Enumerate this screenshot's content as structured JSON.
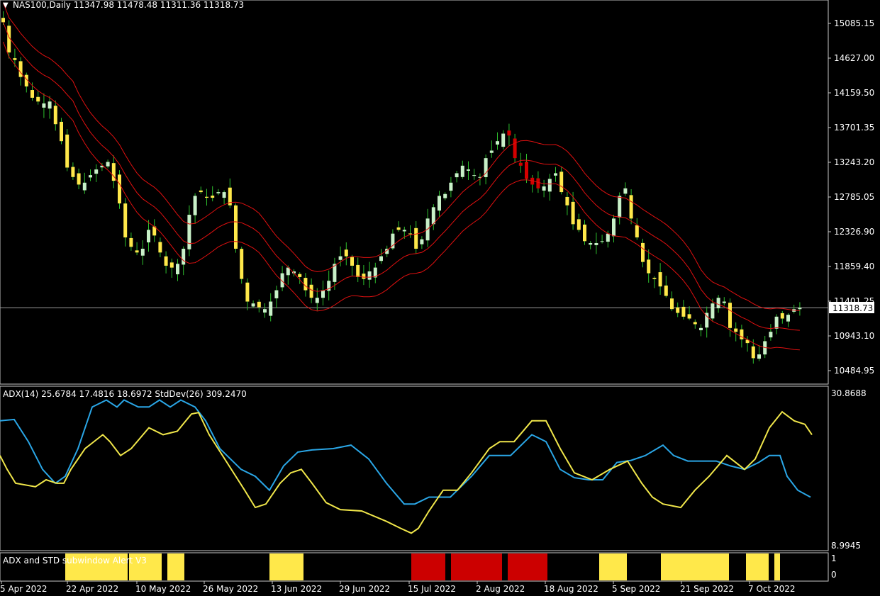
{
  "colors": {
    "background": "#000000",
    "bull_candle": "#c8f0c8",
    "bear_yellow": "#ffe84a",
    "bear_red": "#d40000",
    "wick": "#2dbe2d",
    "envelope": "#e01010",
    "price_line": "#9a9a9a",
    "adx_blue": "#2aa6e6",
    "std_yellow": "#f0e64a",
    "alert_yellow": "#ffe84a",
    "alert_red": "#cc0000",
    "frame": "#c8c8c8"
  },
  "main": {
    "symbol_header": "NAS100,Daily  11347.98 11478.48 11311.36 11318.73",
    "price_tag": "11318.73",
    "current_price": 11318.73
  },
  "adx_panel": {
    "header": "ADX(14) 25.6784 17.4816 18.6972  StdDev(26) 309.2470",
    "scale_top": "30.8688",
    "scale_bottom": "8.9945"
  },
  "alert_panel": {
    "header": "ADX and STD subwindow Alert V3",
    "scale_top": "1",
    "scale_bottom": "0"
  },
  "x_axis": {
    "labels": [
      "5 Apr 2022",
      "22 Apr 2022",
      "10 May 2022",
      "26 May 2022",
      "13 Jun 2022",
      "29 Jun 2022",
      "15 Jul 2022",
      "2 Aug 2022",
      "18 Aug 2022",
      "5 Sep 2022",
      "21 Sep 2022",
      "7 Oct 2022"
    ]
  },
  "chart_data": [
    {
      "type": "candlestick",
      "title": "NAS100,Daily",
      "y_ticks": [
        "15085.15",
        "14627.00",
        "14159.50",
        "13701.35",
        "13243.20",
        "12785.05",
        "12326.90",
        "11859.40",
        "11401.25",
        "10943.10",
        "10484.95"
      ],
      "ylim": [
        10350,
        15250
      ],
      "close_path": [
        [
          0,
          15100
        ],
        [
          2,
          14700
        ],
        [
          4,
          14500
        ],
        [
          6,
          14250
        ],
        [
          8,
          14100
        ],
        [
          10,
          14000
        ],
        [
          12,
          14050
        ],
        [
          14,
          13750
        ],
        [
          16,
          13300
        ],
        [
          18,
          13050
        ],
        [
          20,
          12950
        ],
        [
          22,
          13000
        ],
        [
          24,
          13150
        ],
        [
          26,
          13200
        ],
        [
          28,
          13300
        ],
        [
          30,
          12700
        ],
        [
          32,
          12250
        ],
        [
          34,
          12000
        ],
        [
          36,
          12100
        ],
        [
          38,
          12350
        ],
        [
          40,
          12200
        ],
        [
          42,
          11900
        ],
        [
          44,
          11850
        ],
        [
          46,
          11900
        ],
        [
          48,
          12300
        ],
        [
          50,
          12800
        ],
        [
          52,
          12850
        ],
        [
          54,
          12700
        ],
        [
          56,
          12850
        ],
        [
          58,
          12850
        ],
        [
          60,
          12500
        ],
        [
          62,
          11700
        ],
        [
          64,
          11400
        ],
        [
          66,
          11350
        ],
        [
          68,
          11300
        ],
        [
          70,
          11400
        ],
        [
          72,
          11700
        ],
        [
          74,
          11850
        ],
        [
          76,
          11800
        ],
        [
          78,
          11650
        ],
        [
          80,
          11450
        ],
        [
          82,
          11450
        ],
        [
          84,
          11550
        ],
        [
          86,
          11800
        ],
        [
          88,
          12000
        ],
        [
          90,
          12000
        ],
        [
          92,
          11750
        ],
        [
          94,
          11700
        ],
        [
          96,
          11800
        ],
        [
          98,
          11900
        ],
        [
          100,
          12100
        ],
        [
          102,
          12300
        ],
        [
          104,
          12400
        ],
        [
          106,
          12300
        ],
        [
          108,
          12100
        ],
        [
          110,
          12350
        ],
        [
          112,
          12650
        ],
        [
          114,
          12800
        ],
        [
          116,
          12850
        ],
        [
          118,
          13100
        ],
        [
          120,
          13200
        ],
        [
          122,
          13100
        ],
        [
          124,
          13050
        ],
        [
          126,
          13300
        ],
        [
          128,
          13400
        ],
        [
          130,
          13650
        ],
        [
          132,
          13600
        ],
        [
          134,
          13300
        ],
        [
          136,
          13100
        ],
        [
          138,
          12950
        ],
        [
          140,
          12900
        ],
        [
          142,
          12950
        ],
        [
          144,
          13100
        ],
        [
          146,
          12850
        ],
        [
          148,
          12500
        ],
        [
          150,
          12350
        ],
        [
          152,
          12200
        ],
        [
          154,
          12150
        ],
        [
          156,
          12200
        ],
        [
          158,
          12300
        ],
        [
          160,
          12700
        ],
        [
          162,
          12900
        ],
        [
          164,
          12500
        ],
        [
          166,
          12000
        ],
        [
          168,
          11850
        ],
        [
          170,
          11700
        ],
        [
          172,
          11600
        ],
        [
          174,
          11350
        ],
        [
          176,
          11250
        ],
        [
          178,
          11200
        ],
        [
          180,
          11150
        ],
        [
          182,
          11050
        ],
        [
          184,
          11250
        ],
        [
          186,
          11500
        ],
        [
          188,
          11400
        ],
        [
          190,
          11050
        ],
        [
          192,
          10950
        ],
        [
          194,
          10850
        ],
        [
          196,
          10650
        ],
        [
          198,
          10750
        ],
        [
          200,
          11000
        ],
        [
          202,
          11200
        ],
        [
          204,
          11150
        ],
        [
          206,
          11300
        ],
        [
          208,
          11318.73
        ]
      ]
    },
    {
      "type": "line",
      "title": "ADX(14) 25.6784 17.4816 18.6972  StdDev(26) 309.2470",
      "ylim": [
        8.9945,
        30.8688
      ],
      "series": [
        {
          "values": [
            [
              0,
              27
            ],
            [
              20,
              27.2
            ],
            [
              40,
              24
            ],
            [
              60,
              20
            ],
            [
              78,
              18
            ],
            [
              92,
              19
            ],
            [
              110,
              23
            ],
            [
              130,
              29
            ],
            [
              150,
              30
            ],
            [
              165,
              29
            ],
            [
              175,
              30
            ],
            [
              195,
              29
            ],
            [
              210,
              29
            ],
            [
              225,
              30
            ],
            [
              240,
              29
            ],
            [
              255,
              30
            ],
            [
              275,
              29
            ],
            [
              290,
              27
            ],
            [
              310,
              23
            ],
            [
              340,
              20
            ],
            [
              360,
              19
            ],
            [
              380,
              17
            ],
            [
              400,
              20.5
            ],
            [
              420,
              22.5
            ],
            [
              440,
              22.8
            ],
            [
              470,
              23
            ],
            [
              495,
              23.5
            ],
            [
              520,
              21.5
            ],
            [
              545,
              18
            ],
            [
              570,
              15
            ],
            [
              585,
              15
            ],
            [
              605,
              16
            ],
            [
              635,
              16
            ],
            [
              665,
              19
            ],
            [
              690,
              22
            ],
            [
              720,
              22
            ],
            [
              750,
              25
            ],
            [
              770,
              24
            ],
            [
              790,
              20
            ],
            [
              810,
              18.8
            ],
            [
              830,
              18.5
            ],
            [
              850,
              18.5
            ],
            [
              870,
              21
            ],
            [
              890,
              21.3
            ],
            [
              910,
              22
            ],
            [
              935,
              23.5
            ],
            [
              950,
              22
            ],
            [
              970,
              21.2
            ],
            [
              990,
              21.2
            ],
            [
              1010,
              21.2
            ],
            [
              1030,
              20.5
            ],
            [
              1050,
              20
            ],
            [
              1070,
              21
            ],
            [
              1085,
              22
            ],
            [
              1100,
              22
            ],
            [
              1110,
              19
            ],
            [
              1125,
              17
            ],
            [
              1143,
              16
            ]
          ]
        },
        {
          "values": [
            [
              0,
              22
            ],
            [
              10,
              20
            ],
            [
              22,
              18
            ],
            [
              50,
              17.5
            ],
            [
              65,
              18.5
            ],
            [
              80,
              18
            ],
            [
              90,
              18
            ],
            [
              100,
              20
            ],
            [
              120,
              23
            ],
            [
              145,
              25
            ],
            [
              155,
              24
            ],
            [
              170,
              22
            ],
            [
              185,
              23
            ],
            [
              210,
              26
            ],
            [
              230,
              25
            ],
            [
              250,
              25.5
            ],
            [
              270,
              28
            ],
            [
              280,
              28.2
            ],
            [
              295,
              25
            ],
            [
              320,
              21
            ],
            [
              345,
              17
            ],
            [
              360,
              14.5
            ],
            [
              375,
              15
            ],
            [
              395,
              18
            ],
            [
              410,
              19.5
            ],
            [
              425,
              20
            ],
            [
              440,
              18
            ],
            [
              460,
              15.2
            ],
            [
              480,
              14.2
            ],
            [
              510,
              14
            ],
            [
              545,
              12.5
            ],
            [
              565,
              11.5
            ],
            [
              580,
              10.8
            ],
            [
              590,
              11.5
            ],
            [
              605,
              14
            ],
            [
              625,
              17
            ],
            [
              645,
              17
            ],
            [
              665,
              19.5
            ],
            [
              690,
              23
            ],
            [
              705,
              24
            ],
            [
              725,
              24
            ],
            [
              750,
              27
            ],
            [
              770,
              27
            ],
            [
              790,
              23
            ],
            [
              810,
              19.5
            ],
            [
              835,
              18.5
            ],
            [
              860,
              20
            ],
            [
              885,
              21.2
            ],
            [
              905,
              18
            ],
            [
              920,
              16
            ],
            [
              935,
              15
            ],
            [
              960,
              14.5
            ],
            [
              980,
              17
            ],
            [
              1000,
              19
            ],
            [
              1025,
              22
            ],
            [
              1050,
              20
            ],
            [
              1065,
              21.5
            ],
            [
              1085,
              26
            ],
            [
              1103,
              28.3
            ],
            [
              1120,
              27
            ],
            [
              1135,
              26.5
            ],
            [
              1145,
              25
            ]
          ]
        }
      ]
    },
    {
      "type": "bar",
      "title": "ADX and STD subwindow Alert V3",
      "ylim": [
        0,
        1
      ],
      "blocks": [
        {
          "x0": 92,
          "x1": 180,
          "color": "yellow"
        },
        {
          "x0": 182,
          "x1": 228,
          "color": "yellow"
        },
        {
          "x0": 236,
          "x1": 260,
          "color": "yellow"
        },
        {
          "x0": 380,
          "x1": 428,
          "color": "yellow"
        },
        {
          "x0": 580,
          "x1": 628,
          "color": "red"
        },
        {
          "x0": 636,
          "x1": 708,
          "color": "red"
        },
        {
          "x0": 716,
          "x1": 772,
          "color": "red"
        },
        {
          "x0": 845,
          "x1": 884,
          "color": "yellow"
        },
        {
          "x0": 932,
          "x1": 1028,
          "color": "yellow"
        },
        {
          "x0": 1052,
          "x1": 1084,
          "color": "yellow"
        },
        {
          "x0": 1092,
          "x1": 1100,
          "color": "yellow"
        }
      ]
    }
  ]
}
